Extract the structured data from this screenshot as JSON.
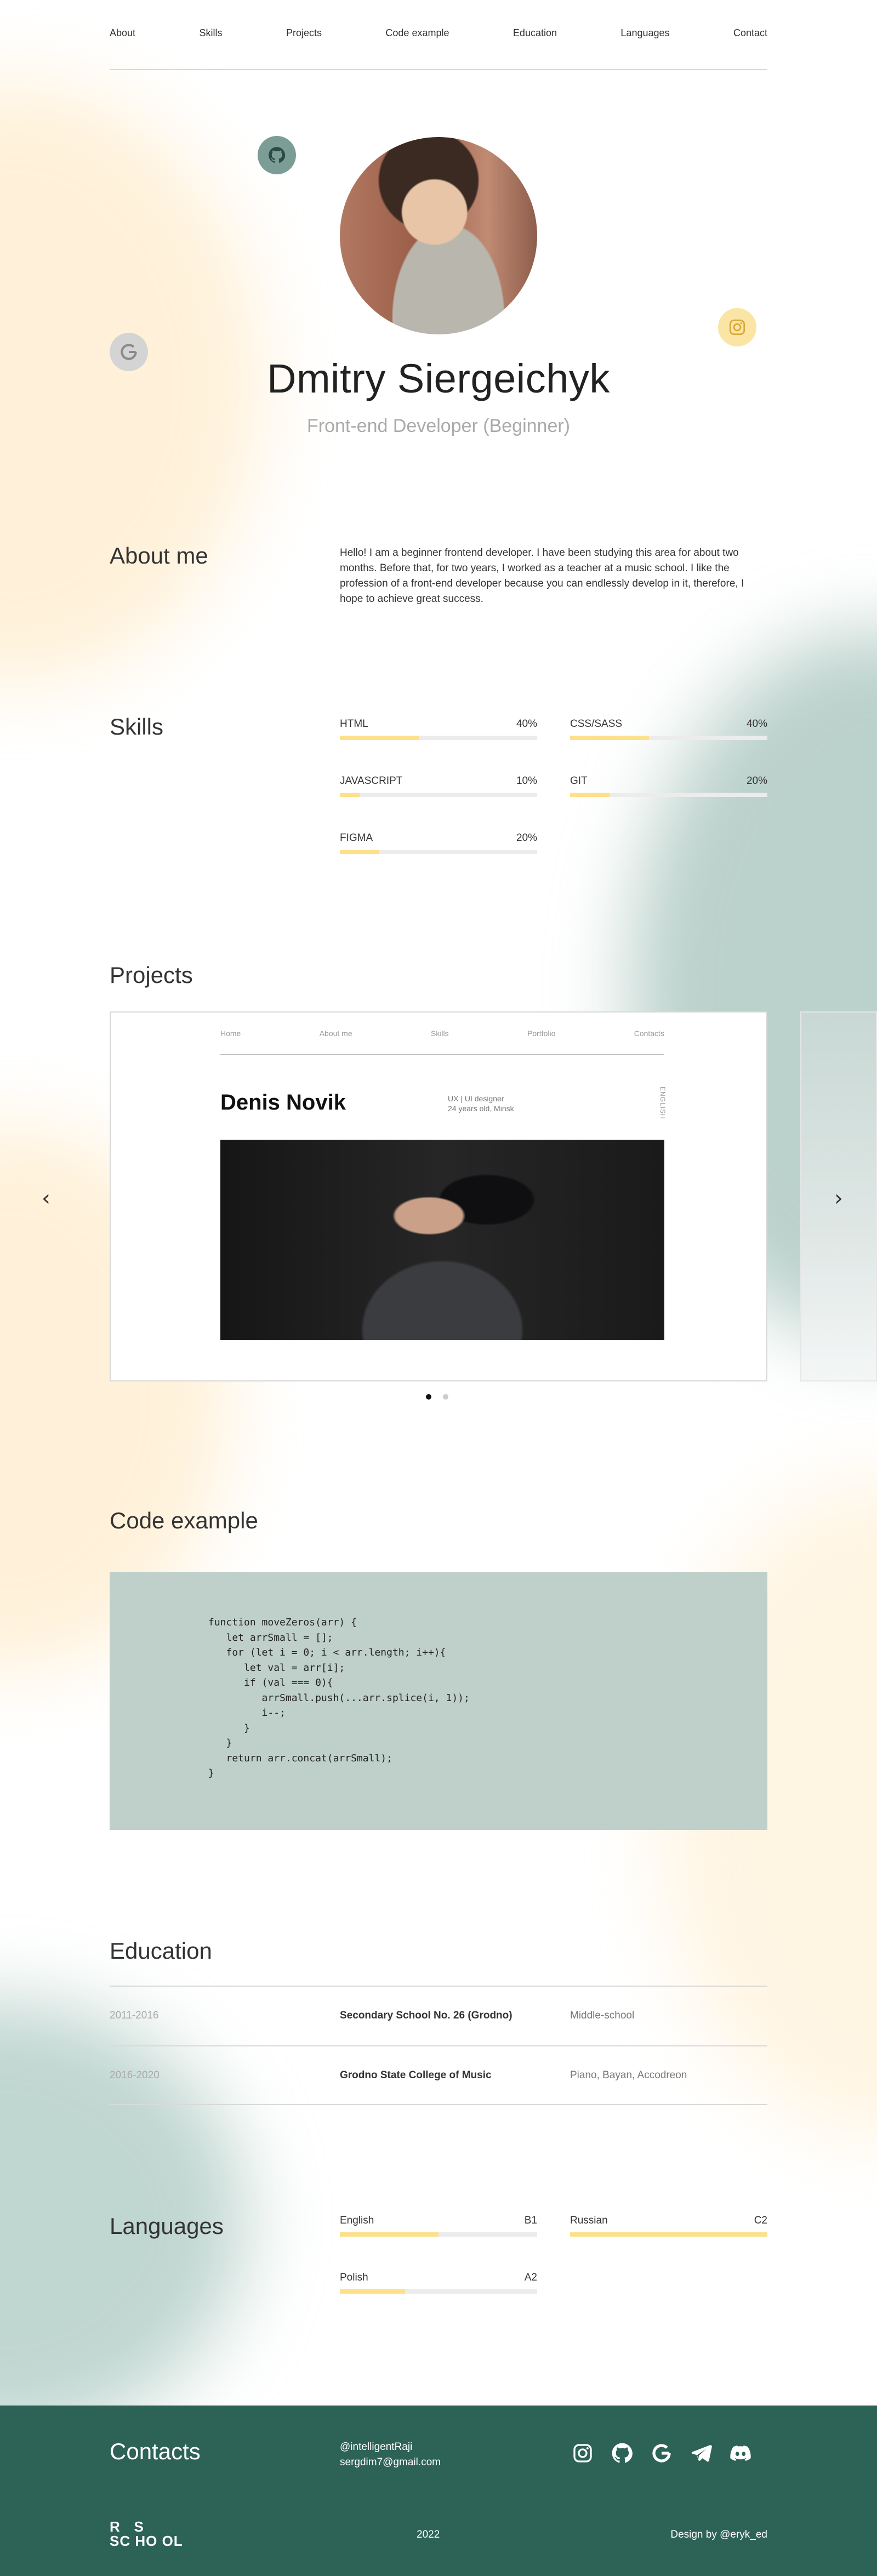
{
  "nav": [
    "About",
    "Skills",
    "Projects",
    "Code example",
    "Education",
    "Languages",
    "Contact"
  ],
  "hero": {
    "name": "Dmitry Siergeichyk",
    "role": "Front-end Developer (Beginner)",
    "social_icons": [
      "github-icon",
      "google-icon",
      "instagram-icon"
    ]
  },
  "about": {
    "title": "About me",
    "text": "Hello! I am a beginner frontend developer. I have been studying this area for about two months. Before that, for two years, I worked as a teacher at a music school. I like the profession of a front-end developer because you can endlessly develop in it, therefore, I hope to achieve great success."
  },
  "skills": {
    "title": "Skills",
    "items": [
      {
        "name": "HTML",
        "label": "40%",
        "value": 0.4
      },
      {
        "name": "CSS/SASS",
        "label": "40%",
        "value": 0.4
      },
      {
        "name": "JAVASCRIPT",
        "label": "10%",
        "value": 0.1
      },
      {
        "name": "GIT",
        "label": "20%",
        "value": 0.2
      },
      {
        "name": "FIGMA",
        "label": "20%",
        "value": 0.2
      }
    ]
  },
  "projects": {
    "title": "Projects",
    "preview": {
      "nav": [
        "Home",
        "About me",
        "Skills",
        "Portfolio",
        "Contacts"
      ],
      "title": "Denis Novik",
      "subtitle_1": "UX | UI designer",
      "subtitle_2": "24 years old, Minsk",
      "vertical_text": "ENGLISH"
    },
    "prev_label": "‹",
    "next_label": "›",
    "slide_count": 2,
    "active_slide": 1
  },
  "code": {
    "title": "Code example",
    "snippet": "function moveZeros(arr) {\n   let arrSmall = [];\n   for (let i = 0; i < arr.length; i++){\n      let val = arr[i];\n      if (val === 0){\n         arrSmall.push(...arr.splice(i, 1));\n         i--;\n      }\n   }\n   return arr.concat(arrSmall);\n}"
  },
  "education": {
    "title": "Education",
    "rows": [
      {
        "years": "2011-2016",
        "school": "Secondary School No. 26 (Grodno)",
        "desc": "Middle-school"
      },
      {
        "years": "2016-2020",
        "school": "Grodno State College of Music",
        "desc": "Piano, Bayan, Accodreon"
      }
    ]
  },
  "languages": {
    "title": "Languages",
    "items": [
      {
        "name": "English",
        "level": "B1",
        "value": 0.5
      },
      {
        "name": "Russian",
        "level": "C2",
        "value": 1.0
      },
      {
        "name": "Polish",
        "level": "A2",
        "value": 0.33
      }
    ]
  },
  "footer": {
    "title": "Contacts",
    "handle": "@intelligentRaji",
    "email": "sergdim7@gmail.com",
    "icons": [
      "instagram-icon",
      "github-icon",
      "google-icon",
      "telegram-icon",
      "discord-icon"
    ],
    "logo_line1": "R   S",
    "logo_line2": "SC HO OL",
    "year": "2022",
    "credit": "Design by @eryk_ed"
  },
  "colors": {
    "accent_yellow": "#fde08a",
    "footer_green": "#2c6356",
    "code_bg": "#bfd0cb"
  }
}
